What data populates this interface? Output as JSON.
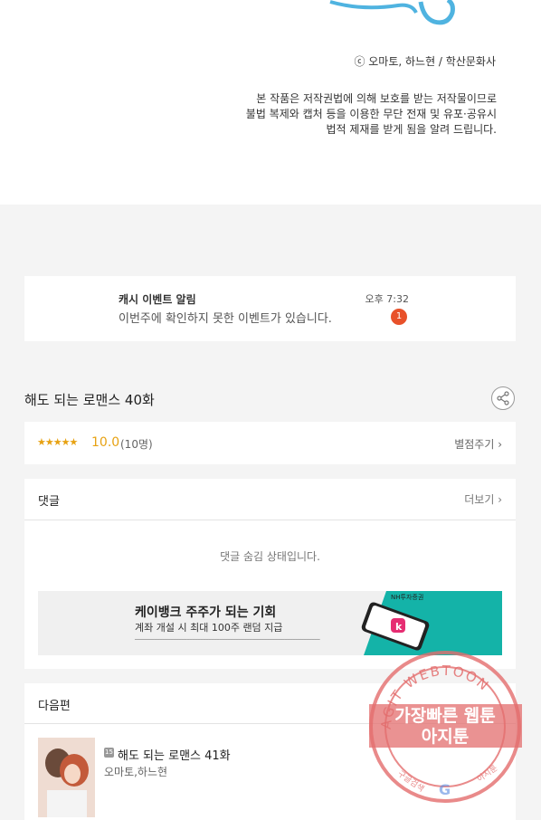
{
  "top": {
    "copyright": "ⓒ 오마토, 하느현 / 학산문화사",
    "notice_lines": [
      "본 작품은 저작권법에 의해 보호를 받는 저작물이므로",
      "불법 복제와 캡처 등을 이용한 무단 전재 및 유포·공유시",
      "법적 제재를 받게 됨을 알려 드립니다."
    ]
  },
  "notification": {
    "title": "캐시 이벤트 알림",
    "message": "이번주에 확인하지 못한 이벤트가 있습니다.",
    "time": "오후 7:32",
    "badge": "1",
    "badge_color": "#e8512a"
  },
  "episode": {
    "title": "해도 되는 로맨스 40화"
  },
  "rating": {
    "stars": "★★★★★",
    "score": "10.0",
    "count": "(10명)",
    "rate_link": "별점주기 ›",
    "accent": "#e7a213"
  },
  "comments": {
    "label": "댓글",
    "more": "더보기 ›",
    "hidden_message": "댓글 숨김 상태입니다."
  },
  "ad": {
    "headline": "케이뱅크 주주가 되는 기회",
    "subline": "계좌 개설 시 최대 100주 랜덤 지급",
    "brand": "NH투자증권"
  },
  "next_episode": {
    "label": "다음편",
    "age": "15",
    "title": "해도 되는 로맨스 41화",
    "author": "오마토,하느현"
  },
  "watermark": {
    "ring_text": "AGIT WEBTOON",
    "line1": "가장빠른 웹툰",
    "line2": "아지툰",
    "left_small": "구글검색",
    "right_small": "아지툰",
    "color": "#e36d6d"
  }
}
